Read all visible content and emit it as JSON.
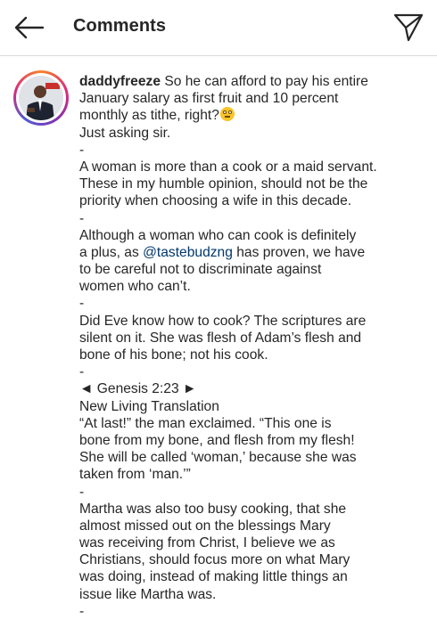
{
  "header": {
    "title": "Comments",
    "back_icon": "arrow-left-icon",
    "share_icon": "paper-plane-icon"
  },
  "comment": {
    "username": "daddyfreeze",
    "lines": [
      "So he can afford to pay his entire",
      "January salary as first fruit and 10 percent",
      "monthly as tithe, right?",
      "Just asking sir.",
      "-",
      "A woman is more than a cook or a maid servant.",
      "These in my humble opinion, should not be the",
      "priority when choosing a wife in this decade.",
      "-",
      "Although a woman who can cook is definitely",
      "a plus, as",
      "@tastebudzng",
      "has proven, we have",
      "to be careful not to discriminate against",
      "women who can’t.",
      "-",
      "Did Eve know how to cook? The scriptures are",
      "silent on it. She was flesh of Adam’s flesh and",
      "bone of his bone; not his cook.",
      "-",
      "◄ Genesis 2:23 ►",
      "New Living Translation",
      "“At last!” the man exclaimed. “This one is",
      "bone from my bone, and flesh from my flesh!",
      "She will be called ‘woman,’ because she was",
      "taken from ‘man.’”",
      "-",
      "Martha was also too busy cooking, that she",
      "almost missed out on the blessings Mary",
      "was receiving from Christ, I believe we as",
      "Christians, should focus more on what Mary",
      "was doing, instead of making little things an",
      "issue like Martha was.",
      "-"
    ],
    "emoji": "face-with-rolling-eyes-emoji",
    "mention_color": "#00376b"
  }
}
